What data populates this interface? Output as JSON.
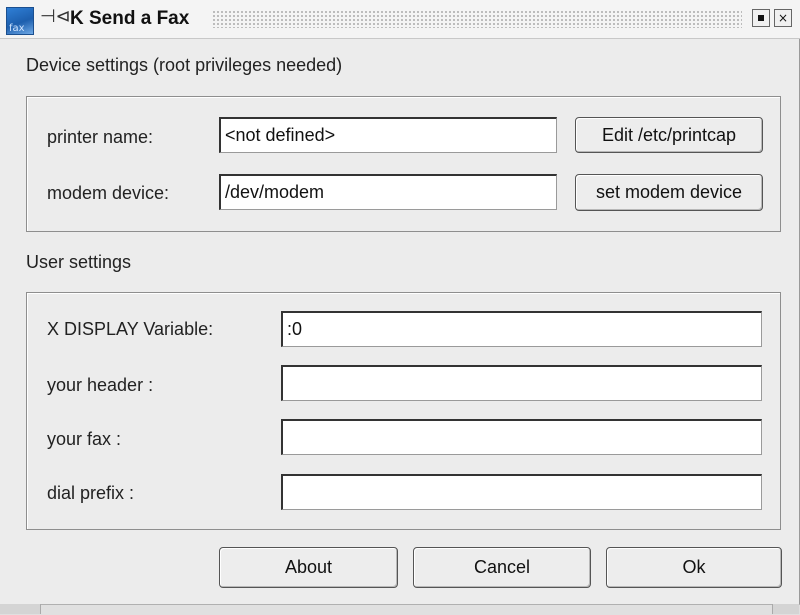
{
  "window": {
    "title": "K Send a Fax",
    "icon_label": "fax",
    "pin_glyph": "⊣⊲",
    "close_glyph": "×"
  },
  "device_settings": {
    "heading": "Device settings (root privileges needed)",
    "printer_label": "printer name:",
    "printer_value": "<not defined>",
    "edit_printcap_button": "Edit /etc/printcap",
    "modem_label": "modem device:",
    "modem_value": "/dev/modem",
    "set_modem_button": "set modem device"
  },
  "user_settings": {
    "heading": "User settings",
    "display_label": "X DISPLAY Variable:",
    "display_value": ":0",
    "header_label": "your header :",
    "header_value": "",
    "fax_label": "your fax :",
    "fax_value": "",
    "dial_prefix_label": "dial prefix :",
    "dial_prefix_value": ""
  },
  "buttons": {
    "about": "About",
    "cancel": "Cancel",
    "ok": "Ok"
  }
}
